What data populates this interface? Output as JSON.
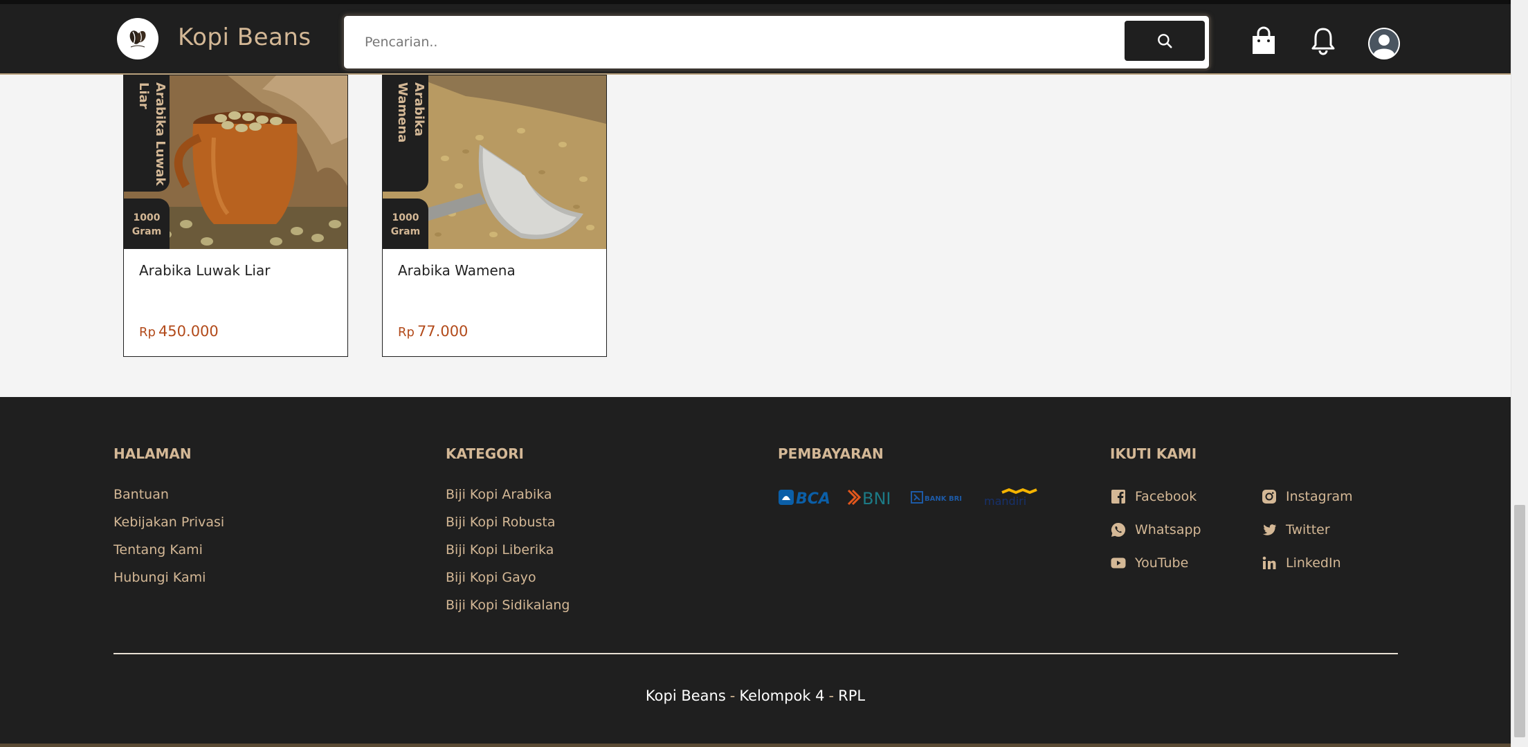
{
  "header": {
    "brand": "Kopi Beans",
    "search_placeholder": "Pencarian.."
  },
  "products": [
    {
      "name": "Arabika Luwak Liar",
      "tag_name": "Arabika Luwak Liar",
      "weight": "1000 Gram",
      "currency": "Rp",
      "price": "450.000"
    },
    {
      "name": "Arabika Wamena",
      "tag_name": "Arabika Wamena",
      "weight": "1000 Gram",
      "currency": "Rp",
      "price": "77.000"
    }
  ],
  "footer": {
    "halaman": {
      "title": "HALAMAN",
      "links": [
        "Bantuan",
        "Kebijakan Privasi",
        "Tentang Kami",
        "Hubungi Kami"
      ]
    },
    "kategori": {
      "title": "KATEGORI",
      "links": [
        "Biji Kopi Arabika",
        "Biji Kopi Robusta",
        "Biji Kopi Liberika",
        "Biji Kopi Gayo",
        "Biji Kopi Sidikalang"
      ]
    },
    "pembayaran": {
      "title": "PEMBAYARAN",
      "logos": [
        "BCA",
        "BNI",
        "BANK BRI",
        "mandiri"
      ]
    },
    "ikuti_kami": {
      "title": "IKUTI KAMI",
      "items": [
        {
          "label": "Facebook",
          "icon": "facebook-icon"
        },
        {
          "label": "Instagram",
          "icon": "instagram-icon"
        },
        {
          "label": "Whatsapp",
          "icon": "whatsapp-icon"
        },
        {
          "label": "Twitter",
          "icon": "twitter-icon"
        },
        {
          "label": "YouTube",
          "icon": "youtube-icon"
        },
        {
          "label": "LinkedIn",
          "icon": "linkedin-icon"
        }
      ]
    },
    "copyright": {
      "brand": "Kopi Beans",
      "group": "Kelompok 4",
      "program": "RPL",
      "separator": "-"
    }
  },
  "colors": {
    "dark": "#1f1f1f",
    "gold": "#d4b896",
    "price": "#b24a1a",
    "page_bg": "#f4f4f4"
  }
}
